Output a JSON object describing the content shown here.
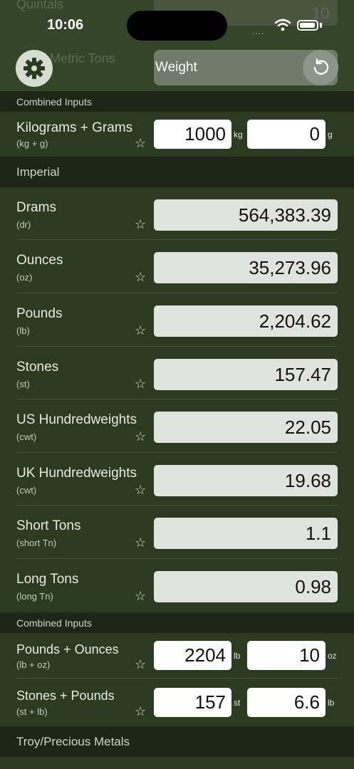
{
  "status_bar": {
    "time": "10:06",
    "signal": "....",
    "wifi_icon": "wifi-icon",
    "battery_icon": "battery-icon"
  },
  "background_ghost": {
    "top_label": "Quintals",
    "top_value": "10",
    "metric_tons": "Metric Tons"
  },
  "header": {
    "title": "Weight",
    "settings_icon": "gear-icon",
    "reset_icon": "undo-icon"
  },
  "combined_metric": {
    "section": "Combined Inputs",
    "row": {
      "label": "Kilograms + Grams",
      "sub": "(kg + g)",
      "value1": "1000",
      "unit1": "kg",
      "value2": "0",
      "unit2": "g"
    }
  },
  "imperial": {
    "section": "Imperial",
    "rows": [
      {
        "label": "Drams",
        "sub": "(dr)",
        "value": "564,383.39"
      },
      {
        "label": "Ounces",
        "sub": "(oz)",
        "value": "35,273.96"
      },
      {
        "label": "Pounds",
        "sub": "(lb)",
        "value": "2,204.62"
      },
      {
        "label": "Stones",
        "sub": "(st)",
        "value": "157.47"
      },
      {
        "label": "US Hundredweights",
        "sub": "(cwt)",
        "value": "22.05"
      },
      {
        "label": "UK Hundredweights",
        "sub": "(cwt)",
        "value": "19.68"
      },
      {
        "label": "Short Tons",
        "sub": "(short Tn)",
        "value": "1.1"
      },
      {
        "label": "Long Tons",
        "sub": "(long Tn)",
        "value": "0.98"
      }
    ]
  },
  "combined_imperial": {
    "section": "Combined Inputs",
    "rows": [
      {
        "label": "Pounds + Ounces",
        "sub": "(lb + oz)",
        "value1": "2204",
        "unit1": "lb",
        "value2": "10",
        "unit2": "oz"
      },
      {
        "label": "Stones + Pounds",
        "sub": "(st + lb)",
        "value1": "157",
        "unit1": "st",
        "value2": "6.6",
        "unit2": "lb"
      }
    ]
  },
  "troy": {
    "section": "Troy/Precious Metals"
  },
  "star_glyph": "☆"
}
